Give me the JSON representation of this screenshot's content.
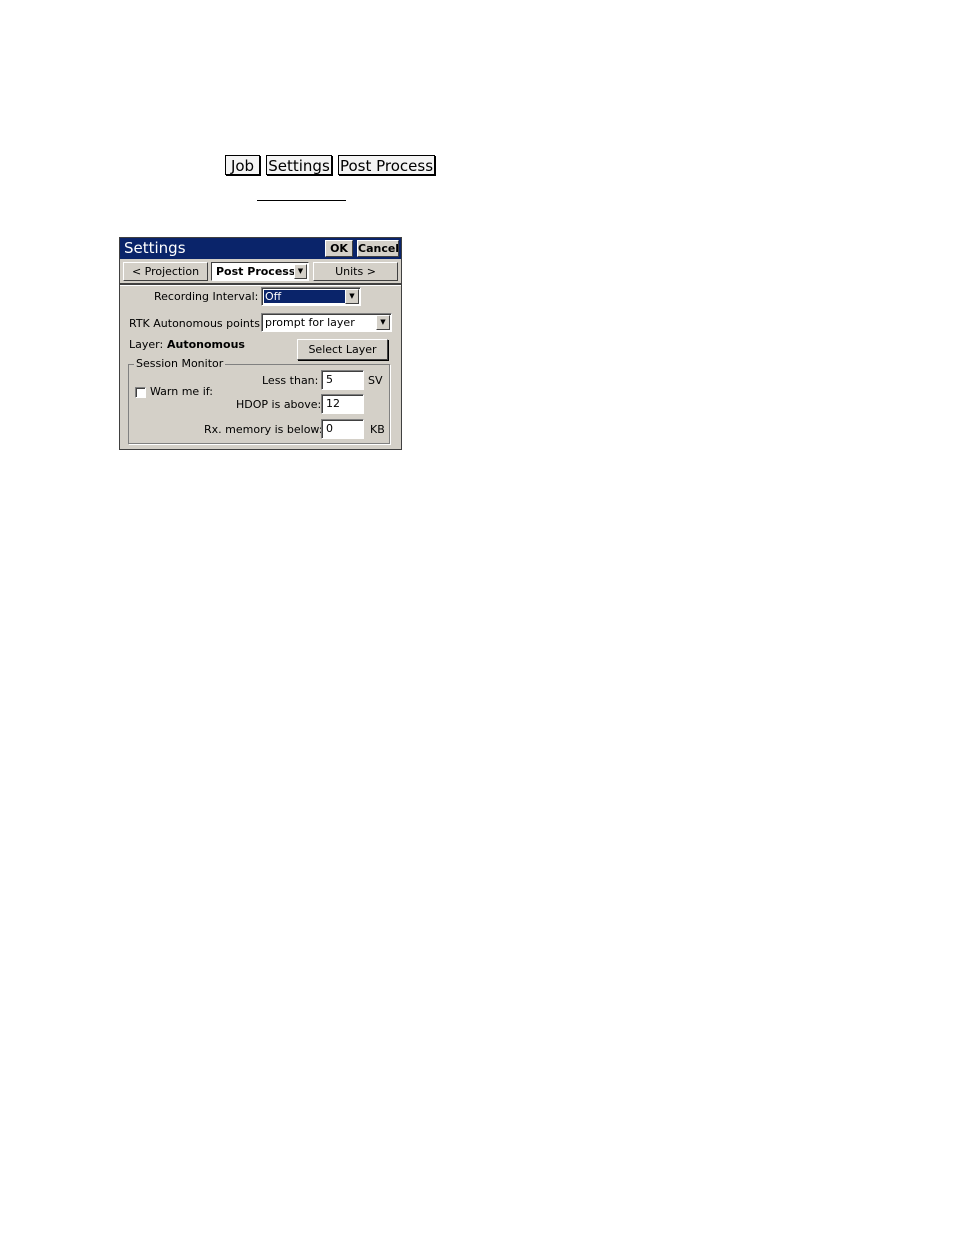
{
  "breadcrumb": {
    "items": [
      "Job",
      "Settings",
      "Post Process"
    ]
  },
  "dialog": {
    "title": "Settings",
    "ok_label": "OK",
    "cancel_label": "Cancel",
    "tabs": {
      "prev": "< Projection",
      "current": "Post Process",
      "next": "Units >"
    },
    "recording_interval": {
      "label": "Recording Interval:",
      "value": "Off"
    },
    "rtk_autonomous": {
      "label": "RTK Autonomous points:",
      "value": "prompt for layer"
    },
    "layer": {
      "label": "Layer:",
      "value": "Autonomous"
    },
    "select_layer_label": "Select Layer",
    "session_monitor": {
      "title": "Session Monitor",
      "warn_label": "Warn me if:",
      "warn_checked": false,
      "less_than": {
        "label": "Less than:",
        "value": "5",
        "unit": "SV"
      },
      "hdop": {
        "label": "HDOP is above:",
        "value": "12"
      },
      "rx_memory": {
        "label": "Rx. memory is below:",
        "value": "0",
        "unit": "KB"
      }
    }
  }
}
